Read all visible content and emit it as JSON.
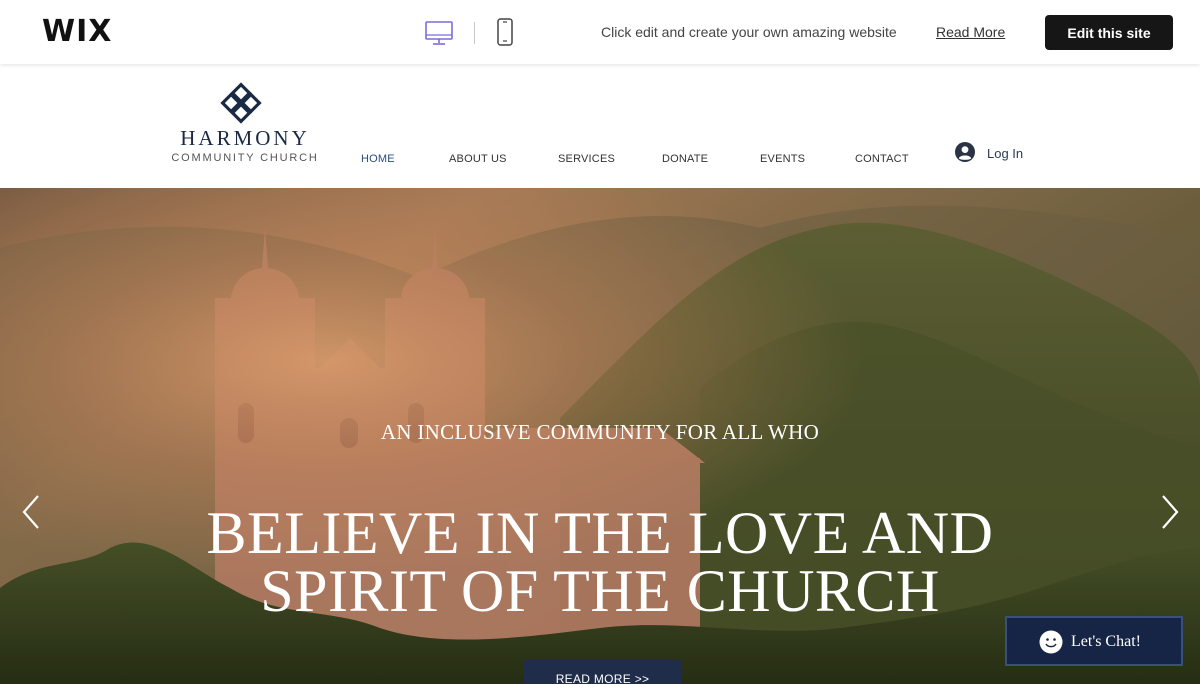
{
  "wixbar": {
    "logo": "WIX",
    "desktop_icon": "desktop-icon",
    "mobile_icon": "mobile-icon",
    "promo_text": "Click edit and create your own amazing website",
    "read_more": "Read More",
    "edit_button": "Edit this site"
  },
  "site": {
    "logo_title": "HARMONY",
    "logo_subtitle": "COMMUNITY CHURCH",
    "nav": [
      {
        "label": "HOME",
        "active": true
      },
      {
        "label": "ABOUT US",
        "active": false
      },
      {
        "label": "SERVICES",
        "active": false
      },
      {
        "label": "DONATE",
        "active": false
      },
      {
        "label": "EVENTS",
        "active": false
      },
      {
        "label": "CONTACT",
        "active": false
      }
    ],
    "login_label": "Log In"
  },
  "hero": {
    "kicker": "AN INCLUSIVE COMMUNITY FOR ALL WHO",
    "title_line1": "BELIEVE IN THE LOVE AND",
    "title_line2": "SPIRIT OF THE CHURCH",
    "cta": "READ MORE >>"
  },
  "chat": {
    "label": "Let's Chat!"
  },
  "colors": {
    "brand_navy": "#1b2a44",
    "nav_active": "#2a4d7a",
    "edit_button_bg": "#161616",
    "chat_bg": "#162546",
    "cta_bg": "#1f2d4a"
  }
}
